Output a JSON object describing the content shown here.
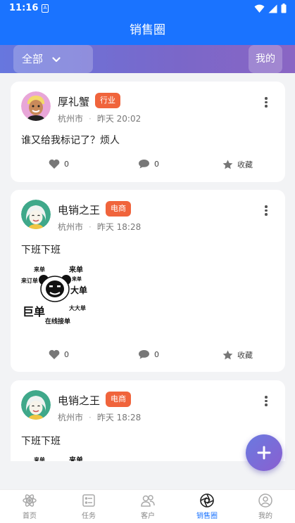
{
  "status_bar": {
    "time": "11:16",
    "sim_label": "A"
  },
  "header": {
    "title": "销售圈"
  },
  "filter_bar": {
    "all_label": "全部",
    "mine_label": "我的"
  },
  "posts": [
    {
      "user": "厚礼蟹",
      "tag": "行业",
      "tag_color": "#f0643c",
      "city": "杭州市",
      "time": "昨天 20:02",
      "text": "谁又给我标记了？烦人",
      "likes": "0",
      "comments": "0",
      "favorite_label": "收藏",
      "has_image": false
    },
    {
      "user": "电销之王",
      "tag": "电商",
      "tag_color": "#f0643c",
      "city": "杭州市",
      "time": "昨天 18:28",
      "text": "下班下班",
      "likes": "0",
      "comments": "0",
      "favorite_label": "收藏",
      "has_image": true
    },
    {
      "user": "电销之王",
      "tag": "电商",
      "tag_color": "#f0643c",
      "city": "杭州市",
      "time": "昨天 18:28",
      "text": "下班下班",
      "has_image": true
    }
  ],
  "meme_words": {
    "w1": "来单",
    "w2": "来单",
    "w3": "来订单",
    "w4": "来单",
    "w5": "大单",
    "w6": "巨单",
    "w7": "大大单",
    "w8": "在线接单"
  },
  "bottom_nav": [
    {
      "label": "首页",
      "icon": "home-icon",
      "active": false
    },
    {
      "label": "任务",
      "icon": "task-icon",
      "active": false
    },
    {
      "label": "客户",
      "icon": "customer-icon",
      "active": false
    },
    {
      "label": "销售圈",
      "icon": "sales-circle-icon",
      "active": true
    },
    {
      "label": "我的",
      "icon": "profile-icon",
      "active": false
    }
  ],
  "colors": {
    "primary": "#1a73ff",
    "tag": "#f0643c",
    "fab_start": "#6a7ae0",
    "fab_end": "#8a5fd0"
  }
}
